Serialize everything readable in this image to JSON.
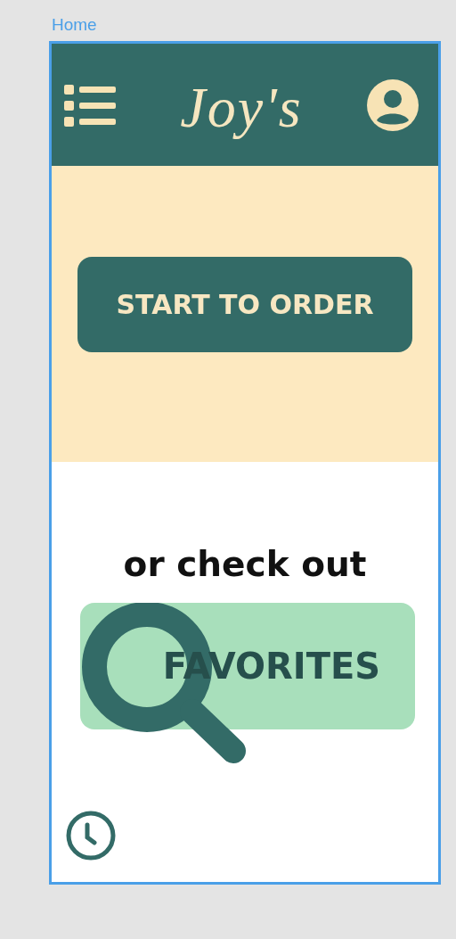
{
  "frame_label": "Home",
  "header": {
    "logo": "Joy's"
  },
  "order_button": "START TO ORDER",
  "prompt": "or check out",
  "favorites_button": "FAVORITES"
}
